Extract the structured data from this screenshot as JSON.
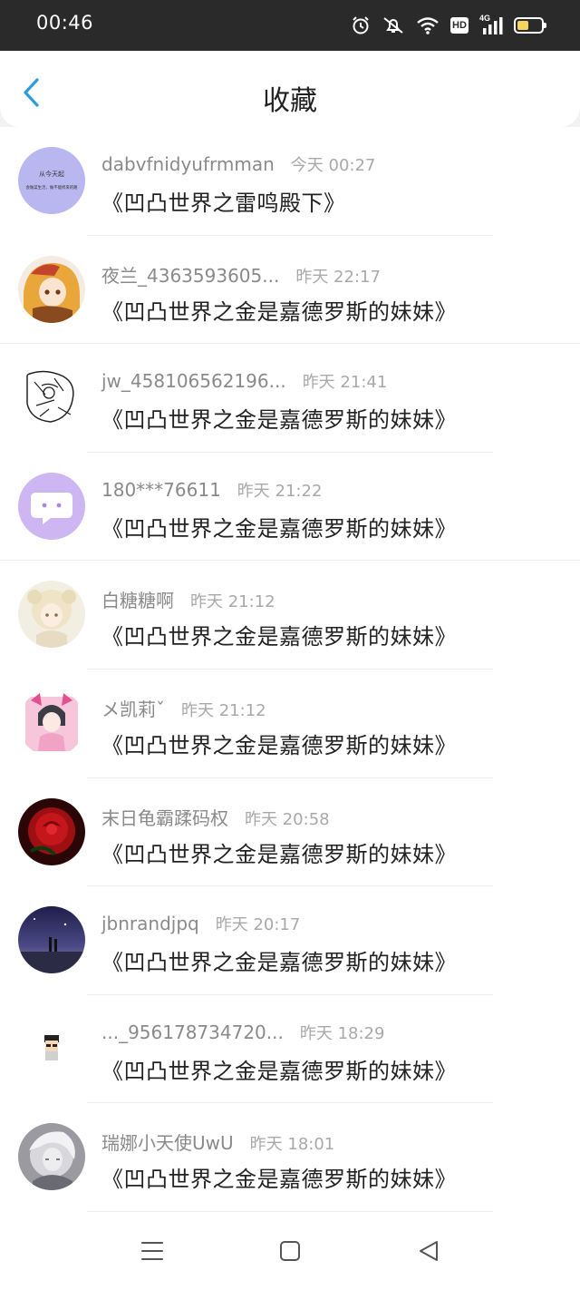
{
  "status_bar": {
    "time": "00:46",
    "hd": "HD",
    "network": "4G"
  },
  "header": {
    "title": "收藏"
  },
  "items": [
    {
      "username": "dabvfnidyufrmman",
      "time": "今天 00:27",
      "message": "《凹凸世界之雷鸣殿下》",
      "avatar_text_1": "从今天起",
      "avatar_text_2": "会做菜生活，做不能修来的路"
    },
    {
      "username": "夜兰_4363593605...",
      "time": "昨天 22:17",
      "message": "《凹凸世界之金是嘉德罗斯的妹妹》"
    },
    {
      "username": "jw_458106562196...",
      "time": "昨天 21:41",
      "message": "《凹凸世界之金是嘉德罗斯的妹妹》"
    },
    {
      "username": "180***76611",
      "time": "昨天 21:22",
      "message": "《凹凸世界之金是嘉德罗斯的妹妹》"
    },
    {
      "username": "白糖糖啊",
      "time": "昨天 21:12",
      "message": "《凹凸世界之金是嘉德罗斯的妹妹》"
    },
    {
      "username": "メ凯莉ˇ",
      "time": "昨天 21:12",
      "message": "《凹凸世界之金是嘉德罗斯的妹妹》"
    },
    {
      "username": "末日龟霸蹂码权",
      "time": "昨天 20:58",
      "message": "《凹凸世界之金是嘉德罗斯的妹妹》"
    },
    {
      "username": "jbnrandjpq",
      "time": "昨天 20:17",
      "message": "《凹凸世界之金是嘉德罗斯的妹妹》"
    },
    {
      "username": "..._956178734720...",
      "time": "昨天 18:29",
      "message": "《凹凸世界之金是嘉德罗斯的妹妹》"
    },
    {
      "username": "瑞娜小天使UwU",
      "time": "昨天 18:01",
      "message": "《凹凸世界之金是嘉德罗斯的妹妹》"
    }
  ]
}
